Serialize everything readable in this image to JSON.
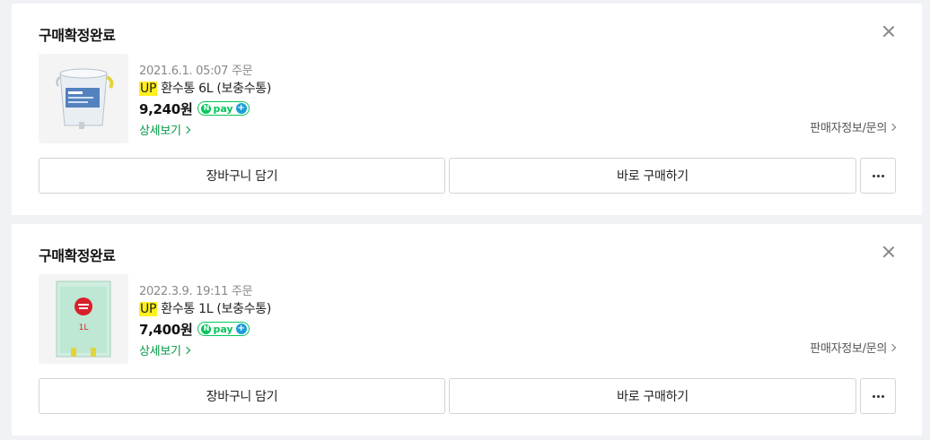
{
  "orders": [
    {
      "status": "구매확정완료",
      "date": "2021.6.1. 05:07 주문",
      "badge": "UP",
      "product_name": "환수통 6L (보충수통)",
      "price": "9,240원",
      "npay_label": "pay",
      "detail_link": "상세보기",
      "seller_link": "판매자정보/문의",
      "cart_button": "장바구니 담기",
      "buy_button": "바로 구매하기"
    },
    {
      "status": "구매확정완료",
      "date": "2022.3.9. 19:11 주문",
      "badge": "UP",
      "product_name": "환수통 1L (보충수통)",
      "price": "7,400원",
      "npay_label": "pay",
      "detail_link": "상세보기",
      "seller_link": "판매자정보/문의",
      "cart_button": "장바구니 담기",
      "buy_button": "바로 구매하기",
      "thumb_label": "1L"
    }
  ],
  "colors": {
    "accent_green": "#03c75a",
    "link_green": "#009a45",
    "highlight_yellow": "#fff11e"
  }
}
